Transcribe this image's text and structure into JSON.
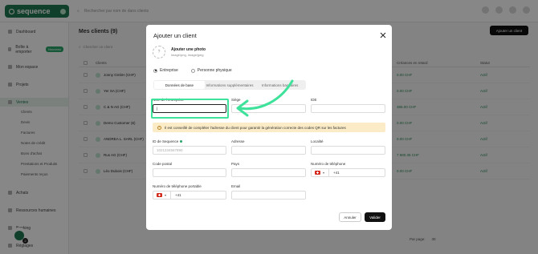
{
  "app": {
    "brand": "sequence",
    "search_placeholder": "Rechercher par nom de dans clients"
  },
  "sidebar": {
    "items": [
      {
        "label": "Dashboard"
      },
      {
        "label": "Boîte à emporter",
        "badge": "Nouveau"
      },
      {
        "label": "Mon espace"
      },
      {
        "label": "Projets"
      },
      {
        "label": "Ventes"
      }
    ],
    "sub_items": [
      "Clients",
      "Devis",
      "Factures",
      "Notes de crédit",
      "Bons d'achat",
      "Prestations et Produits",
      "Paiements reçus"
    ],
    "bottom_items": [
      {
        "label": "Achats"
      },
      {
        "label": "Ressources humaines"
      },
      {
        "label": "Banking"
      },
      {
        "label": "Réglages"
      }
    ]
  },
  "page": {
    "title": "Mes clients (9)",
    "add_client_label": "Ajouter un client",
    "search_placeholder": "Chercher un client",
    "columns": {
      "clients": "Clients",
      "receivables": "Créances en retard",
      "status": "Statut"
    },
    "rows": [
      {
        "name": "Jonny GmbH (CHF)",
        "amount": "0.00 CHF",
        "status": "Actif"
      },
      {
        "name": "Yer SA (CHF)",
        "amount": "0.00 CHF",
        "status": "Actif"
      },
      {
        "name": "C & N AG (CHF)",
        "amount": "386.00 CHF",
        "status": "Actif"
      },
      {
        "name": "Demo Customer (€)",
        "amount": "0.00 CHF",
        "status": "Actif"
      },
      {
        "name": "ANDREA L. SARL (CHF)",
        "amount": "0.00 CHF",
        "status": "Actif"
      },
      {
        "name": "Rus AG (CHF)",
        "amount": "7 980.35 CHF",
        "status": "Actif"
      },
      {
        "name": "Léo Dubois (CHF)",
        "amount": "0.00 CHF",
        "status": "Actif"
      }
    ],
    "pagination": {
      "per_page_label": "Par page:",
      "per_page_value": "30"
    }
  },
  "modal": {
    "title": "Ajouter un client",
    "photo": {
      "title": "Ajouter une photo",
      "types": "image/png, image/jpeg",
      "glyph": "?"
    },
    "entity_types": {
      "company": "Entreprise",
      "person": "Personne physique",
      "selected": "company"
    },
    "tabs": [
      "Données de base",
      "Informations supplémentaires",
      "Informations bancaires"
    ],
    "active_tab": 0,
    "fields": {
      "company_name": {
        "label": "Nom de l'entreprise *",
        "value": "|"
      },
      "seat": {
        "label": "Siège",
        "value": ""
      },
      "ide": {
        "label": "IDE",
        "value": ""
      },
      "sequence_id": {
        "label": "ID de Sequence",
        "placeholder": "1021234567890"
      },
      "address": {
        "label": "Adresse",
        "value": ""
      },
      "locality": {
        "label": "Localité",
        "value": ""
      },
      "postcode": {
        "label": "Code postal",
        "value": ""
      },
      "country": {
        "label": "Pays",
        "value": ""
      },
      "phone": {
        "label": "Numéro de téléphone",
        "prefix": "+41"
      },
      "mobile": {
        "label": "Numéro de téléphone portable",
        "prefix": "+41"
      },
      "email": {
        "label": "Email",
        "value": ""
      }
    },
    "warning": "Il est conseillé de compléter l'adresse du client pour garantir la génération correcte des codes QR sur les factures",
    "warning_glyph": "!",
    "chevron": "▾",
    "cancel_label": "Annuler",
    "submit_label": "Valider"
  },
  "colors": {
    "brand": "#1f7a52",
    "highlight": "#3ee29a",
    "warning_bg": "#fbecc7",
    "overlay": "rgba(0,0,0,0.47)"
  },
  "icons": [
    "close-icon",
    "photo-placeholder-icon",
    "warning-icon",
    "swiss-flag-icon",
    "chevron-down-icon",
    "arrow-annotation-icon",
    "info-dot-icon"
  ],
  "fab": {
    "count": "2"
  }
}
